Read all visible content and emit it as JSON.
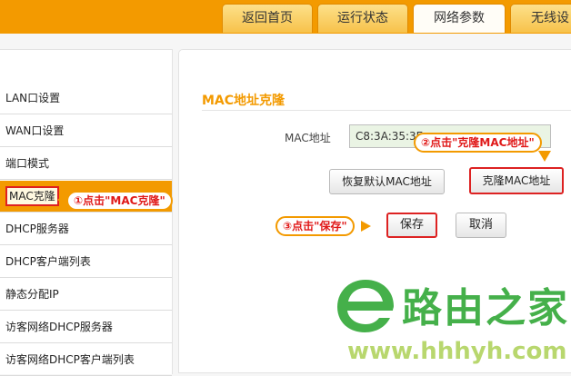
{
  "tabs": [
    {
      "label": "返回首页",
      "active": false
    },
    {
      "label": "运行状态",
      "active": false
    },
    {
      "label": "网络参数",
      "active": true
    },
    {
      "label": "无线设",
      "active": false
    }
  ],
  "sidebar": {
    "items": [
      {
        "label": "LAN口设置"
      },
      {
        "label": "WAN口设置"
      },
      {
        "label": "端口模式"
      },
      {
        "label": "MAC克隆",
        "active": true
      },
      {
        "label": "DHCP服务器"
      },
      {
        "label": "DHCP客户端列表"
      },
      {
        "label": "静态分配IP"
      },
      {
        "label": "访客网络DHCP服务器"
      },
      {
        "label": "访客网络DHCP客户端列表"
      }
    ]
  },
  "main": {
    "section_title": "MAC地址克隆",
    "mac_label": "MAC地址",
    "mac_value": "C8:3A:35:3E",
    "restore_button": "恢复默认MAC地址",
    "clone_button": "克隆MAC地址",
    "save_button": "保存",
    "cancel_button": "取消"
  },
  "callouts": {
    "step1": "①点击\"MAC克隆\"",
    "step2": "②点击\"克隆MAC地址\"",
    "step3": "③点击\"保存\""
  },
  "watermark": {
    "name": "路由之家",
    "url": "www.hhhyh.com"
  },
  "colors": {
    "accent": "#f39a00",
    "highlight": "#e02020",
    "watermark_green": "#45b04a"
  }
}
